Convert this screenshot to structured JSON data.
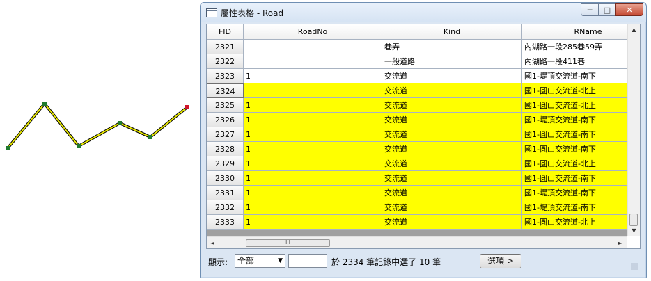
{
  "window": {
    "title": "屬性表格 - Road",
    "title_icon": "table-icon",
    "minimize_glyph": "─",
    "maximize_glyph": "□",
    "close_glyph": "✕"
  },
  "columns": [
    "FID",
    "RoadNo",
    "Kind",
    "RName"
  ],
  "rows": [
    {
      "fid": "2321",
      "roadno": "",
      "kind": "巷弄",
      "rname": "內湖路一段285巷59弄",
      "selected": false
    },
    {
      "fid": "2322",
      "roadno": "",
      "kind": "一般道路",
      "rname": "內湖路一段411巷",
      "selected": false
    },
    {
      "fid": "2323",
      "roadno": "1",
      "kind": "交流道",
      "rname": "國1-堤頂交流道-南下",
      "selected": false
    },
    {
      "fid": "2324",
      "roadno": "",
      "kind": "交流道",
      "rname": "國1-圓山交流道-北上",
      "selected": true
    },
    {
      "fid": "2325",
      "roadno": "1",
      "kind": "交流道",
      "rname": "國1-圓山交流道-北上",
      "selected": true
    },
    {
      "fid": "2326",
      "roadno": "1",
      "kind": "交流道",
      "rname": "國1-堤頂交流道-南下",
      "selected": true
    },
    {
      "fid": "2327",
      "roadno": "1",
      "kind": "交流道",
      "rname": "國1-圓山交流道-南下",
      "selected": true
    },
    {
      "fid": "2328",
      "roadno": "1",
      "kind": "交流道",
      "rname": "國1-圓山交流道-南下",
      "selected": true
    },
    {
      "fid": "2329",
      "roadno": "1",
      "kind": "交流道",
      "rname": "國1-圓山交流道-北上",
      "selected": true
    },
    {
      "fid": "2330",
      "roadno": "1",
      "kind": "交流道",
      "rname": "國1-圓山交流道-南下",
      "selected": true
    },
    {
      "fid": "2331",
      "roadno": "1",
      "kind": "交流道",
      "rname": "國1-堤頂交流道-南下",
      "selected": true
    },
    {
      "fid": "2332",
      "roadno": "1",
      "kind": "交流道",
      "rname": "國1-堤頂交流道-南下",
      "selected": true
    },
    {
      "fid": "2333",
      "roadno": "1",
      "kind": "交流道",
      "rname": "國1-圓山交流道-北上",
      "selected": true
    }
  ],
  "scroll": {
    "up": "▲",
    "down": "▼",
    "left": "◄",
    "right": "►",
    "grip": "III"
  },
  "status": {
    "show_label": "顯示:",
    "show_value": "全部",
    "dropdown_glyph": "▼",
    "count_value": "",
    "summary": "於 2334 筆記錄中選了 10 筆",
    "options_label": "選項 >"
  },
  "colors": {
    "selection": "#ffff00",
    "line": "#e8e800",
    "vertex": "#1f7a2e",
    "end_vertex": "#d0152a"
  }
}
